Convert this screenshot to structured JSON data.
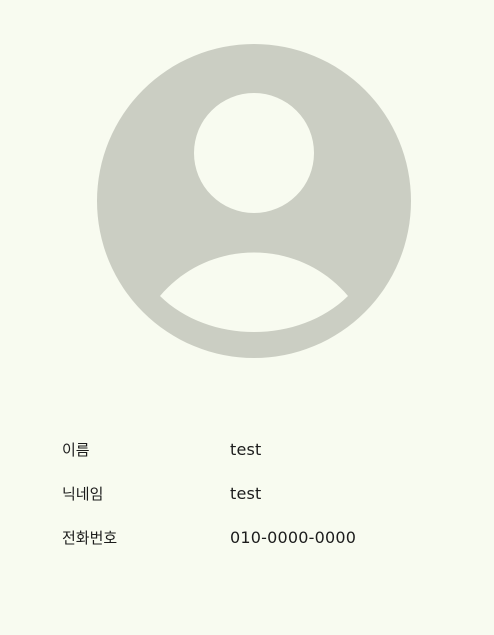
{
  "profile": {
    "avatar_icon": "user-avatar-icon",
    "avatar_color": "#cbcec3",
    "background_color": "#f8fbf0",
    "fields": [
      {
        "label": "이름",
        "value": "test"
      },
      {
        "label": "닉네임",
        "value": "test"
      },
      {
        "label": "전화번호",
        "value": "010-0000-0000"
      }
    ]
  }
}
